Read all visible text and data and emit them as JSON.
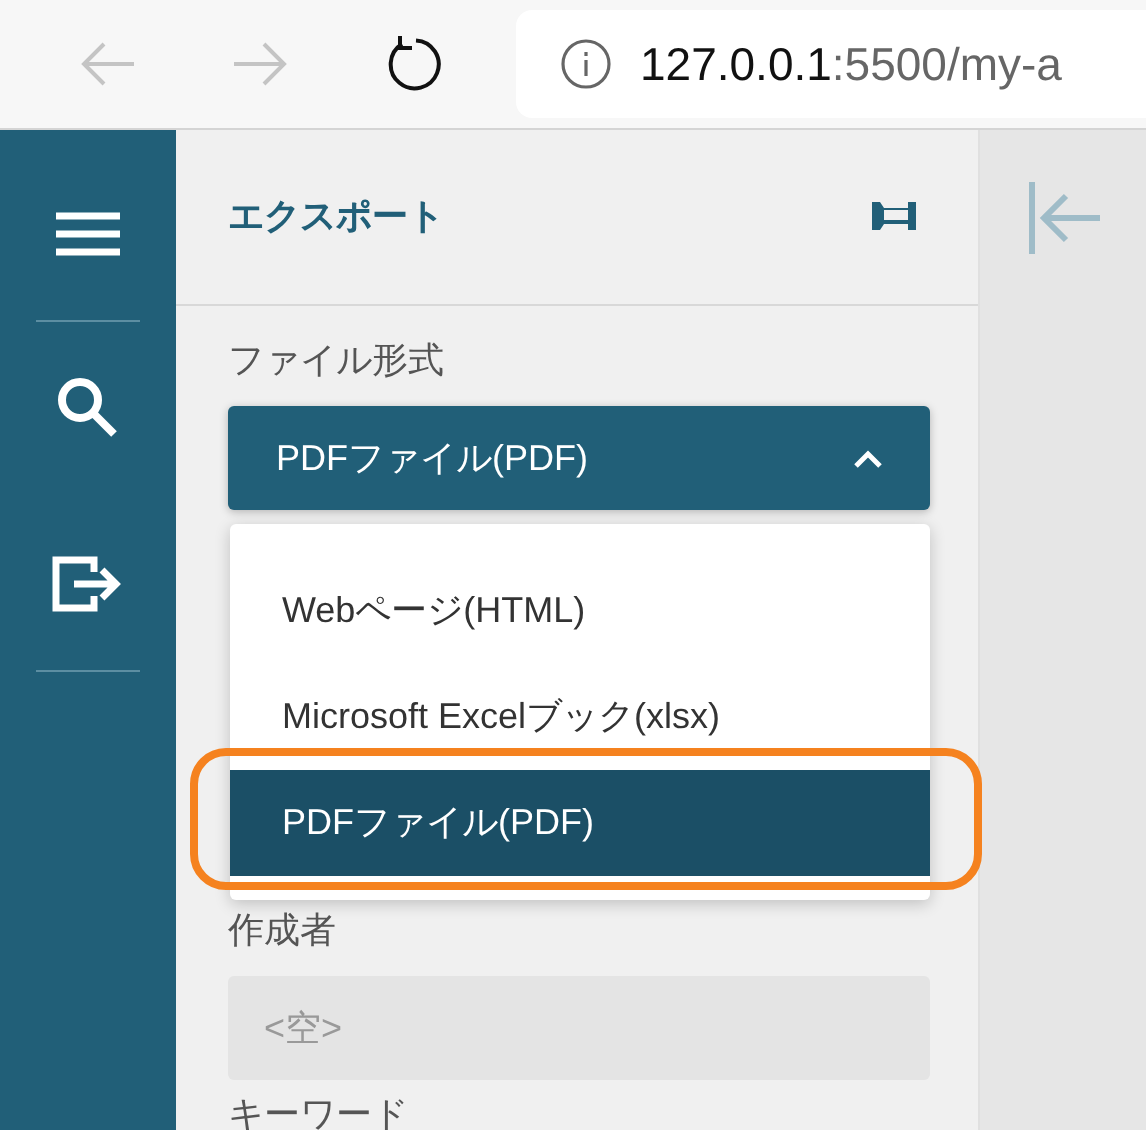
{
  "browser": {
    "back_enabled": false,
    "forward_enabled": false,
    "url_host": "127.0.0.1",
    "url_rest": ":5500/my-a"
  },
  "sidebar": {
    "items": [
      {
        "kind": "menu"
      },
      {
        "kind": "search"
      },
      {
        "kind": "export"
      }
    ]
  },
  "panel": {
    "title": "エクスポート"
  },
  "fields": [
    {
      "kind": "select",
      "label": "ファイル形式",
      "value": "PDFファイル(PDF)",
      "expanded": true,
      "options": [
        {
          "label": "Webページ(HTML)",
          "selected": false
        },
        {
          "label": "Microsoft Excelブック(xlsx)",
          "selected": false
        },
        {
          "label": "PDFファイル(PDF)",
          "selected": true
        }
      ]
    },
    {
      "kind": "text",
      "label": "作成者",
      "placeholder": "<空>"
    },
    {
      "kind": "label",
      "label": "キーワード"
    }
  ]
}
